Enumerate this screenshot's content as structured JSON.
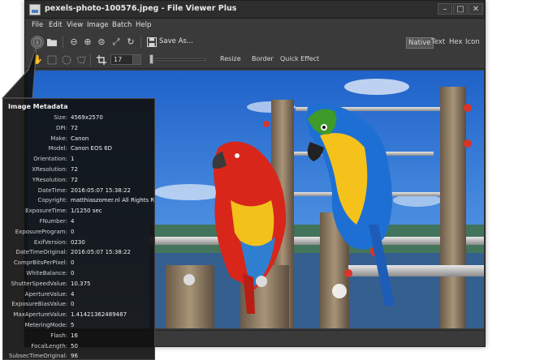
{
  "window": {
    "title": "pexels-photo-100576.jpeg - File Viewer Plus",
    "minimize": "–",
    "maximize": "□",
    "close": "✕"
  },
  "menu": [
    "File",
    "Edit",
    "View",
    "Image",
    "Batch",
    "Help"
  ],
  "toolbar": {
    "save_label": "Save As...",
    "modes": [
      "Native",
      "Text",
      "Hex",
      "Icon"
    ],
    "active_mode": "Native"
  },
  "toolbar2": {
    "zoom_value": "17",
    "resize": "Resize",
    "border": "Border",
    "quick_effect": "Quick Effect"
  },
  "metadata": {
    "title": "Image Metadata",
    "rows": [
      {
        "key": "Size:",
        "value": "4569x2570"
      },
      {
        "key": "DPI:",
        "value": "72"
      },
      {
        "key": "Make:",
        "value": "Canon"
      },
      {
        "key": "Model:",
        "value": "Canon EOS 6D"
      },
      {
        "key": "Orientation:",
        "value": "1"
      },
      {
        "key": "XResolution:",
        "value": "72"
      },
      {
        "key": "YResolution:",
        "value": "72"
      },
      {
        "key": "DateTime:",
        "value": "2016:05:07 15:38:22"
      },
      {
        "key": "Copyright:",
        "value": "matthiaszomer.nl All Rights Res"
      },
      {
        "key": "ExposureTime:",
        "value": "1/1250 sec"
      },
      {
        "key": "FNumber:",
        "value": "4"
      },
      {
        "key": "ExposureProgram:",
        "value": "0"
      },
      {
        "key": "ExifVersion:",
        "value": "0230"
      },
      {
        "key": "DateTimeOriginal:",
        "value": "2016:05:07 15:38:22"
      },
      {
        "key": "ComprBitsPerPixel:",
        "value": "0"
      },
      {
        "key": "WhiteBalance:",
        "value": "0"
      },
      {
        "key": "ShutterSpeedValue:",
        "value": "10.375"
      },
      {
        "key": "ApertureValue:",
        "value": "4"
      },
      {
        "key": "ExposureBiasValue:",
        "value": "0"
      },
      {
        "key": "MaxApertureValue:",
        "value": "1.41421362489487"
      },
      {
        "key": "MeteringMode:",
        "value": "5"
      },
      {
        "key": "Flash:",
        "value": "16"
      },
      {
        "key": "FocalLength:",
        "value": "50"
      },
      {
        "key": "SubsecTimeOriginal:",
        "value": "96"
      }
    ]
  },
  "icons": {
    "info": "info-icon",
    "open": "folder-icon",
    "zoom_out": "zoom-out-icon",
    "zoom_in": "zoom-in-icon",
    "zoom_fit": "zoom-fit-icon",
    "fullscreen": "fullscreen-icon",
    "rotate": "rotate-icon",
    "save": "save-icon",
    "hand": "hand-icon",
    "select_rect": "rect-select-icon",
    "select_ellipse": "ellipse-select-icon",
    "select_lasso": "lasso-select-icon",
    "crop": "crop-icon"
  },
  "colors": {
    "window_bg": "#3a3a3a",
    "titlebar_bg": "#2d2d2d",
    "panel_bg": "#101010",
    "sky": "#2a6fd0"
  }
}
